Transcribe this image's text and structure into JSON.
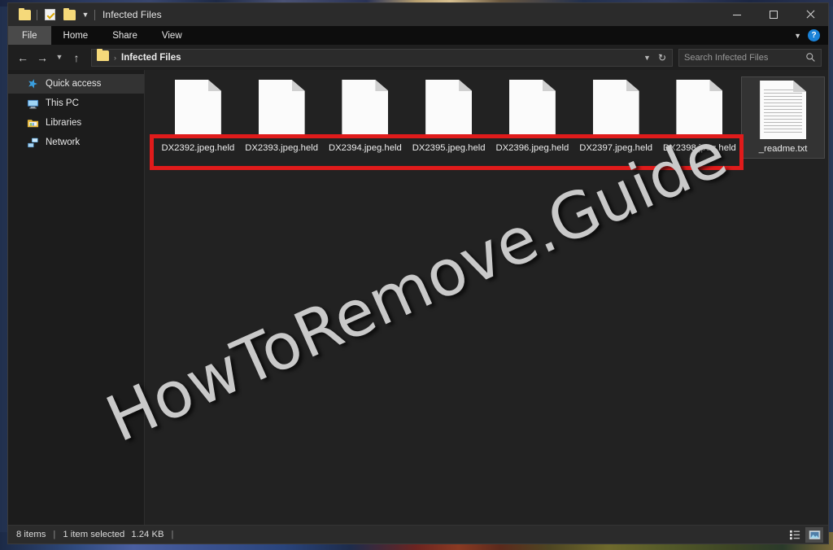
{
  "window": {
    "title": "Infected Files",
    "controls": {
      "minimize": "minimize-button",
      "maximize": "maximize-button",
      "close": "close-button"
    }
  },
  "quick_access_toolbar": {
    "items": [
      {
        "name": "folder-icon",
        "label": "Open folder"
      },
      {
        "name": "properties-icon",
        "label": "Properties"
      },
      {
        "name": "new-folder-icon",
        "label": "New folder"
      },
      {
        "name": "chevron-down-icon",
        "label": "Customize Quick Access Toolbar"
      }
    ]
  },
  "ribbon": {
    "tabs": [
      {
        "label": "File",
        "active": true
      },
      {
        "label": "Home",
        "active": false
      },
      {
        "label": "Share",
        "active": false
      },
      {
        "label": "View",
        "active": false
      }
    ],
    "collapse_icon": "chevron-down-icon",
    "help_label": "?"
  },
  "navigation": {
    "back_icon": "arrow-left-icon",
    "forward_icon": "arrow-right-icon",
    "recent_icon": "chevron-down-icon",
    "up_icon": "arrow-up-icon",
    "address": {
      "folder_icon": "folder-icon",
      "separator": "›",
      "path": "Infected Files",
      "dropdown_icon": "chevron-down-icon",
      "refresh_icon": "refresh-icon"
    },
    "search": {
      "placeholder": "Search Infected Files",
      "value": "",
      "icon": "search-icon"
    }
  },
  "sidebar": {
    "items": [
      {
        "label": "Quick access",
        "icon": "star-icon",
        "selected": true
      },
      {
        "label": "This PC",
        "icon": "computer-icon",
        "selected": false
      },
      {
        "label": "Libraries",
        "icon": "libraries-folder-icon",
        "selected": false
      },
      {
        "label": "Network",
        "icon": "network-icon",
        "selected": false
      }
    ]
  },
  "files": [
    {
      "name": "DX2392.jpeg.held",
      "icon": "blank-document-icon",
      "selected": false
    },
    {
      "name": "DX2393.jpeg.held",
      "icon": "blank-document-icon",
      "selected": false
    },
    {
      "name": "DX2394.jpeg.held",
      "icon": "blank-document-icon",
      "selected": false
    },
    {
      "name": "DX2395.jpeg.held",
      "icon": "blank-document-icon",
      "selected": false
    },
    {
      "name": "DX2396.jpeg.held",
      "icon": "blank-document-icon",
      "selected": false
    },
    {
      "name": "DX2397.jpeg.held",
      "icon": "blank-document-icon",
      "selected": false
    },
    {
      "name": "DX2398.jpeg.held",
      "icon": "blank-document-icon",
      "selected": false
    },
    {
      "name": "_readme.txt",
      "icon": "text-document-icon",
      "selected": true
    }
  ],
  "annotation": {
    "highlight_color": "#e01b1b",
    "shape": "rectangle"
  },
  "watermark": {
    "text": "HowToRemove.Guide",
    "color": "#c9c9c9"
  },
  "statusbar": {
    "item_count": "8 items",
    "separator_1": "|",
    "selection": "1 item selected",
    "selection_size": "1.24 KB",
    "separator_2": "|",
    "view_buttons": [
      {
        "name": "details-view-button",
        "active": false
      },
      {
        "name": "large-icons-view-button",
        "active": true
      }
    ]
  }
}
